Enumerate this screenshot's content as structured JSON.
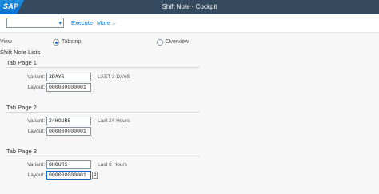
{
  "shell": {
    "logo_text": "SAP",
    "title": "Shift Note - Cockpit"
  },
  "toolbar": {
    "execute_label": "Execute",
    "more_label": "More"
  },
  "view": {
    "label": "View",
    "options": [
      {
        "label": "Tabstrip",
        "selected": true
      },
      {
        "label": "Overview",
        "selected": false
      }
    ]
  },
  "section_title": "Shift Note Lists",
  "tabs": [
    {
      "title": "Tab Page 1",
      "variant_label": "Variant:",
      "variant": "3DAYS",
      "variant_desc": "LAST 3 DAYS",
      "layout_label": "Layout:",
      "layout": "000000000001"
    },
    {
      "title": "Tab Page 2",
      "variant_label": "Variant:",
      "variant": "24HOURS",
      "variant_desc": "Last 24 Hours",
      "layout_label": "Layout:",
      "layout": "000000000001"
    },
    {
      "title": "Tab Page 3",
      "variant_label": "Variant:",
      "variant": "8HOURS",
      "variant_desc": "Last 8 Hours",
      "layout_label": "Layout:",
      "layout": "000000000001"
    }
  ]
}
